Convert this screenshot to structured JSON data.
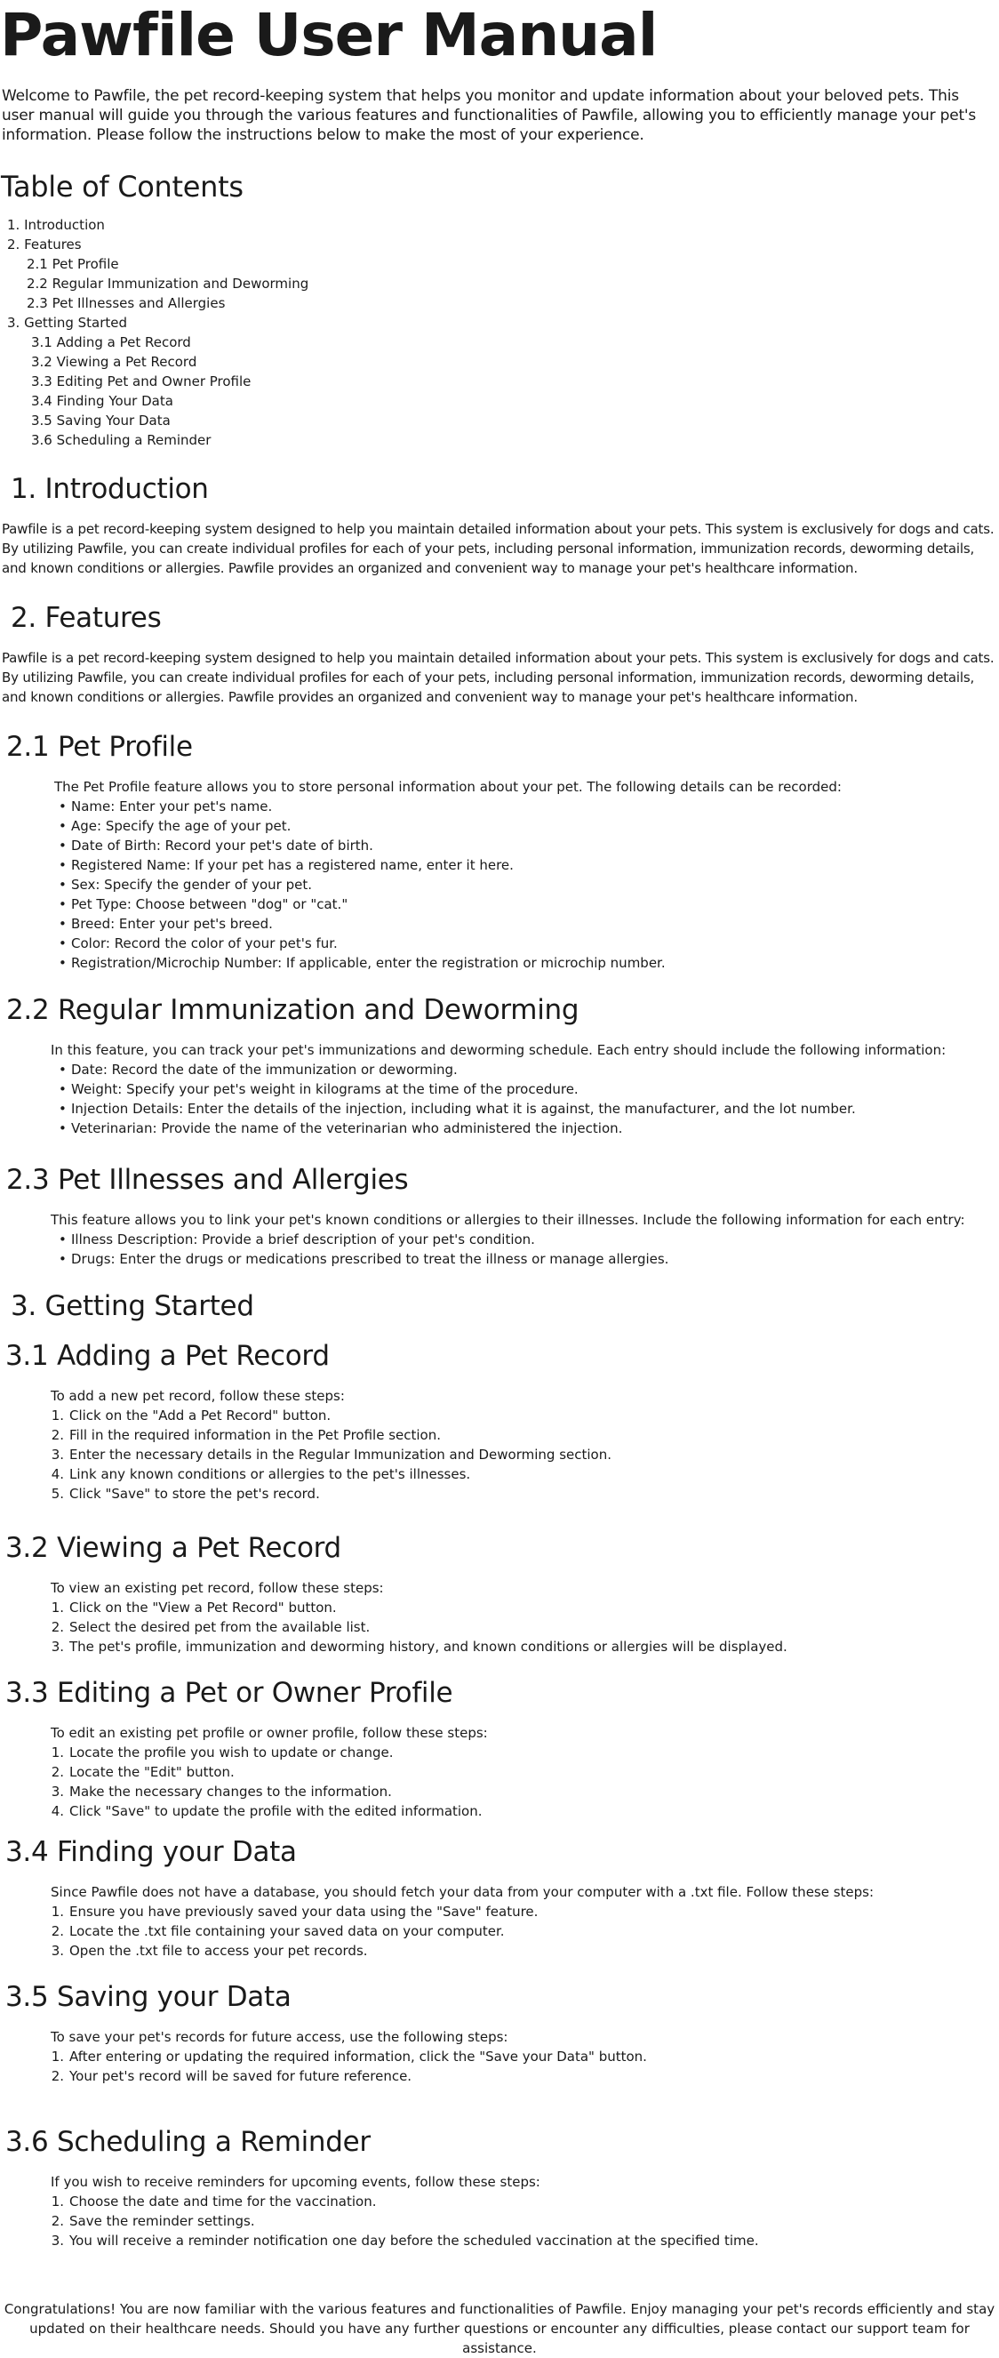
{
  "title": "Pawfile User Manual",
  "intro": "Welcome to Pawfile, the pet record-keeping system that helps you monitor and update information about your beloved pets. This user manual will guide you through the various features and functionalities of Pawfile, allowing you to efficiently manage your pet's information. Please follow the instructions below to make the most of your experience.",
  "toc": {
    "heading": "Table of Contents",
    "items": [
      "1. Introduction",
      "2. Features",
      "2.1 Pet Profile",
      "2.2 Regular Immunization and Deworming",
      "2.3 Pet Illnesses and Allergies",
      "3. Getting Started",
      "3.1 Adding a Pet Record",
      "3.2 Viewing a Pet Record",
      "3.3 Editing Pet and Owner Profile",
      "3.4 Finding Your Data",
      "3.5 Saving Your Data",
      "3.6 Scheduling a Reminder"
    ]
  },
  "introduction": {
    "heading": "1. Introduction",
    "body": "Pawfile is a pet record-keeping system designed to help you maintain detailed information about your pets. This system is exclusively for dogs and cats. By utilizing Pawfile, you can create individual profiles for each of your pets, including personal information, immunization records, deworming details, and known conditions or allergies. Pawfile provides an organized and convenient way to manage your pet's healthcare information."
  },
  "features": {
    "heading": "2. Features",
    "body": "Pawfile is a pet record-keeping system designed to help you maintain detailed information about your pets. This system is exclusively for dogs and cats. By utilizing Pawfile, you can create individual profiles for each of your pets, including personal information, immunization records, deworming details, and known conditions or allergies. Pawfile provides an organized and convenient way to manage your pet's healthcare information."
  },
  "pet_profile": {
    "heading": "2.1 Pet Profile",
    "lead": "The Pet Profile feature allows you to store personal information about your pet. The following details can be recorded:",
    "items": [
      "Name: Enter your pet's name.",
      "Age: Specify the age of your pet.",
      "Date of Birth: Record your pet's date of birth.",
      "Registered Name: If your pet has a registered name, enter it here.",
      "Sex: Specify the gender of your pet.",
      "Pet Type: Choose between \"dog\" or \"cat.\"",
      "Breed: Enter your pet's breed.",
      "Color: Record the color of your pet's fur.",
      "Registration/Microchip Number: If applicable, enter the registration or microchip number."
    ]
  },
  "immunization": {
    "heading": "2.2 Regular Immunization and Deworming",
    "lead": "In this feature, you can track your pet's immunizations and deworming schedule. Each entry should include the following information:",
    "items": [
      "Date: Record the date of the immunization or deworming.",
      "Weight: Specify your pet's weight in kilograms at the time of the procedure.",
      "Injection Details: Enter the details of the injection, including what it is against, the manufacturer, and the lot number.",
      "Veterinarian: Provide the name of the veterinarian who administered the injection."
    ]
  },
  "illnesses": {
    "heading": "2.3 Pet Illnesses and Allergies",
    "lead": "This feature allows you to link your pet's known conditions or allergies to their illnesses. Include the following information for each entry:",
    "items": [
      "Illness Description: Provide a brief description of your pet's condition.",
      "Drugs: Enter the drugs or medications prescribed to treat the illness or manage allergies."
    ]
  },
  "getting_started": {
    "heading": "3. Getting Started"
  },
  "adding": {
    "heading": "3.1 Adding a Pet Record",
    "lead": "To add a new pet record, follow these steps:",
    "items": [
      "Click on the \"Add a Pet Record\" button.",
      "Fill in the required information in the Pet Profile section.",
      "Enter the necessary details in the Regular Immunization and Deworming section.",
      "Link any known conditions or allergies to the pet's illnesses.",
      "Click \"Save\" to store the pet's record."
    ]
  },
  "viewing": {
    "heading": "3.2 Viewing a Pet Record",
    "lead": "To view an existing pet record, follow these steps:",
    "items": [
      "Click on the \"View a Pet Record\" button.",
      "Select the desired pet from the available list.",
      "The pet's profile, immunization and deworming history, and known conditions or allergies will be displayed."
    ]
  },
  "editing": {
    "heading": "3.3  Editing a Pet or Owner Profile",
    "lead": "To edit an existing pet profile or owner profile, follow these steps:",
    "items": [
      "Locate the profile you wish to update or change.",
      "Locate the \"Edit\" button.",
      "Make the necessary changes to the information.",
      "Click \"Save\" to update the profile with the edited information."
    ]
  },
  "finding": {
    "heading": "3.4 Finding your Data",
    "lead": "Since Pawfile does not have a database, you should fetch your data from your computer with a .txt file. Follow these steps:",
    "items": [
      "Ensure you have previously saved your data using the \"Save\" feature.",
      "Locate the .txt file containing your saved data on your computer.",
      "Open the .txt file to access your pet records."
    ]
  },
  "saving": {
    "heading": "3.5 Saving your Data",
    "lead": "To save your pet's records for future access, use the following steps:",
    "items": [
      "After entering or updating the required information, click the \"Save your Data\" button.",
      "Your pet's record will be saved for future reference."
    ]
  },
  "reminder": {
    "heading": "3.6 Scheduling a Reminder",
    "lead": "If you wish to receive reminders for upcoming events, follow these steps:",
    "items": [
      "Choose the date and time for the vaccination.",
      "Save the reminder settings.",
      "You will receive a reminder notification one day before the scheduled vaccination at the specified time."
    ]
  },
  "closing": "Congratulations! You are now familiar with the various features and functionalities of Pawfile. Enjoy managing your pet's records efficiently and stay updated on their healthcare needs. Should you have any further questions or encounter any difficulties, please contact our support team for assistance."
}
